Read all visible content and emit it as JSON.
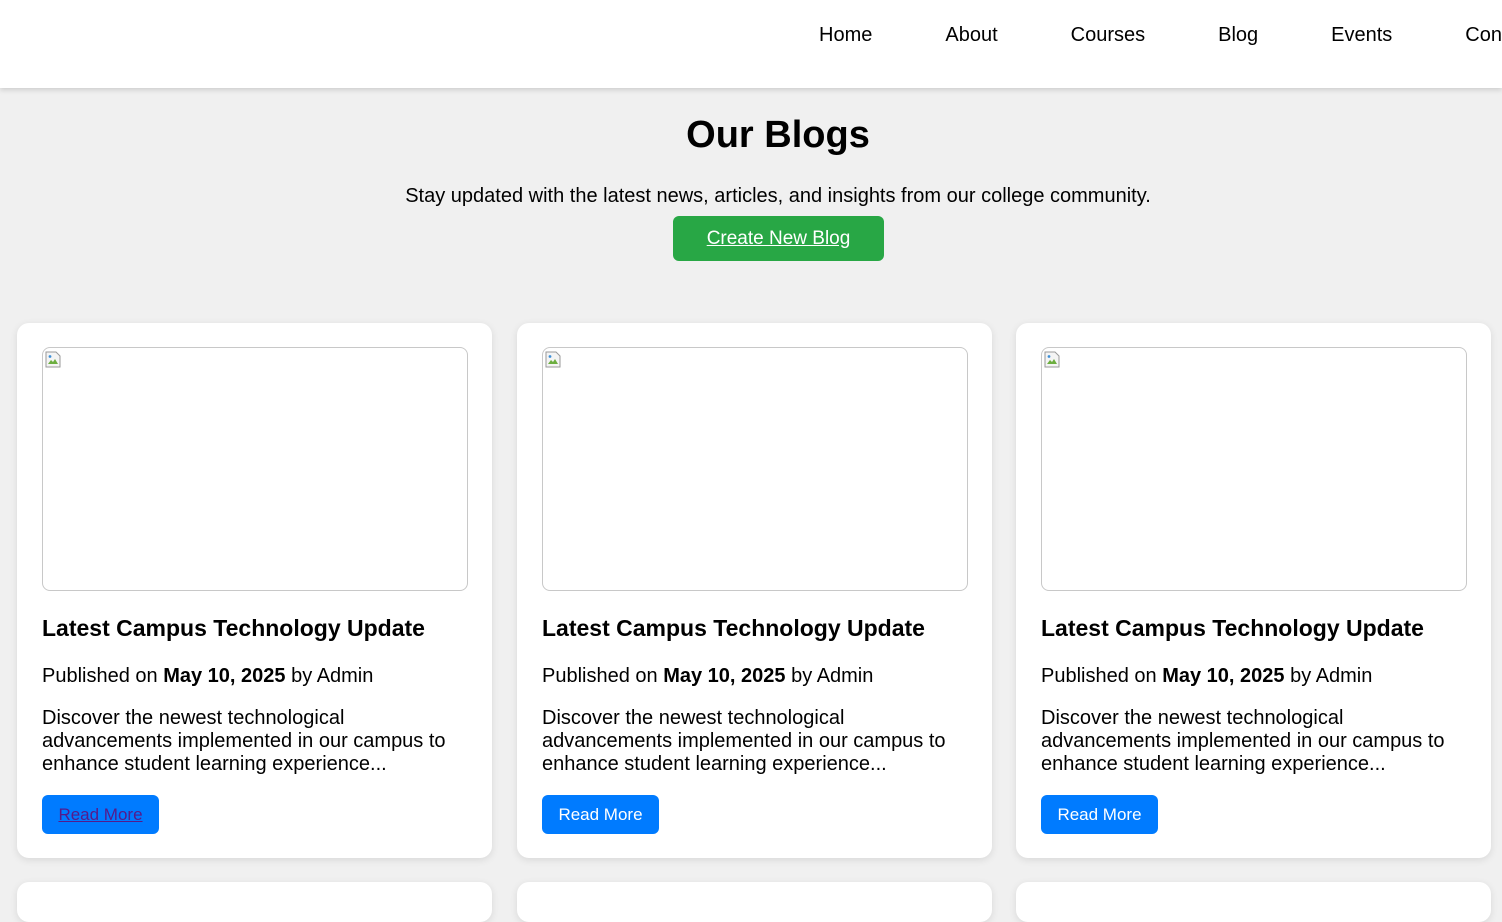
{
  "nav": {
    "links": [
      "Home",
      "About",
      "Courses",
      "Blog",
      "Events",
      "Contact"
    ]
  },
  "hero": {
    "title": "Our Blogs",
    "subtitle": "Stay updated with the latest news, articles, and insights from our college community.",
    "create_button": "Create New Blog"
  },
  "posts": [
    {
      "title": "Latest Campus Technology Update",
      "published_prefix": "Published on",
      "date": "May 10, 2025",
      "by_prefix": "by",
      "author": "Admin",
      "excerpt": "Discover the newest technological advancements implemented in our campus to enhance student learning experience...",
      "read_more": "Read More"
    },
    {
      "title": "Latest Campus Technology Update",
      "published_prefix": "Published on",
      "date": "May 10, 2025",
      "by_prefix": "by",
      "author": "Admin",
      "excerpt": "Discover the newest technological advancements implemented in our campus to enhance student learning experience...",
      "read_more": "Read More"
    },
    {
      "title": "Latest Campus Technology Update",
      "published_prefix": "Published on",
      "date": "May 10, 2025",
      "by_prefix": "by",
      "author": "Admin",
      "excerpt": "Discover the newest technological advancements implemented in our campus to enhance student learning experience...",
      "read_more": "Read More"
    }
  ],
  "colors": {
    "page_background": "#f0f0f0",
    "create_button": "#28a745",
    "read_more_button": "#007bff",
    "visited_link": "#551a8b"
  },
  "icons": {
    "image_placeholder": "broken-image-icon"
  }
}
